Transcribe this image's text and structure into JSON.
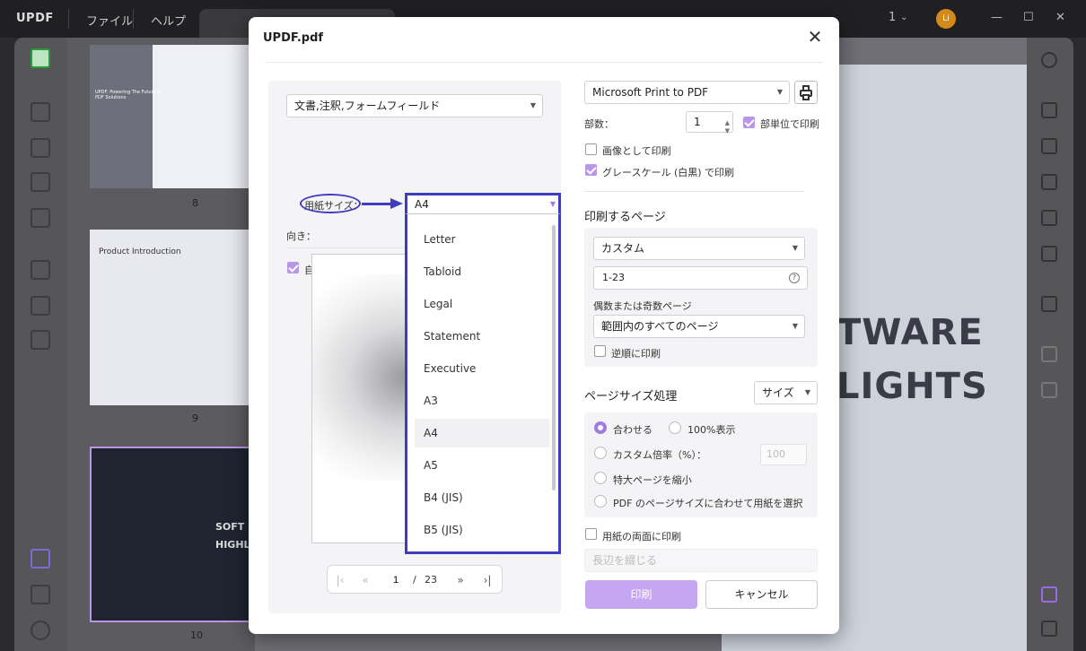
{
  "app": {
    "logo": "UPDF",
    "menu": [
      "ファイル",
      "ヘルプ"
    ],
    "page_indicator": "1",
    "avatar_initial": "Li",
    "accent_color": "#b996e8"
  },
  "thumbnails": {
    "page_numbers": [
      "8",
      "9",
      "10"
    ],
    "page8_title": "UPDF: Powering The Future Of PDF Solutions",
    "page9_title": "Product Introduction",
    "page10_title": "SOFT HIGHL"
  },
  "canvas": {
    "heading_line1": "TWARE",
    "heading_line2": "LIGHTS"
  },
  "dialog": {
    "title": "UPDF.pdf",
    "content_select": "文書,注釈,フォームフィールド",
    "paper_size_label": "用紙サイズ：",
    "paper_size_value": "A4",
    "paper_sizes": [
      "Letter",
      "Tabloid",
      "Legal",
      "Statement",
      "Executive",
      "A3",
      "A4",
      "A5",
      "B4 (JIS)",
      "B5 (JIS)"
    ],
    "orientation_label": "向き：",
    "auto_rotate_label": "自動回転",
    "pager": {
      "current": "1",
      "separator": "/",
      "total": "23"
    },
    "printer": "Microsoft Print to PDF",
    "copies_label": "部数：",
    "copies_value": "1",
    "collate_label": "部単位で印刷",
    "print_as_image_label": "画像として印刷",
    "grayscale_label": "グレースケール (白黒) で印刷",
    "pages_section_title": "印刷するページ",
    "pages_mode": "カスタム",
    "pages_range": "1-23",
    "odd_even_label": "偶数または奇数ページ",
    "odd_even_value": "範囲内のすべてのページ",
    "reverse_label": "逆順に印刷",
    "page_size_section_title": "ページサイズ処理",
    "page_size_mode": "サイズ",
    "fit_label": "合わせる",
    "actual_size_label": "100%表示",
    "custom_scale_label": "カスタム倍率（%）：",
    "custom_scale_value": "100",
    "shrink_label": "特大ページを縮小",
    "choose_by_pdf_label": "PDF のページサイズに合わせて用紙を選択",
    "duplex_label": "用紙の両面に印刷",
    "binding_value": "長辺を綴じる",
    "print_button": "印刷",
    "cancel_button": "キャンセル"
  }
}
